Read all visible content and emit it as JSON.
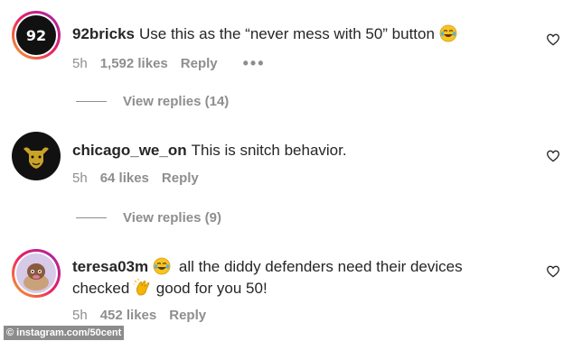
{
  "comments": [
    {
      "username": "92bricks",
      "text_before": "Use this as the “never mess with 50” button",
      "text_after": "",
      "time": "5h",
      "likes": "1,592 likes",
      "reply": "Reply",
      "more": "•••",
      "view_replies": "View replies (14)",
      "avatar_text": "92"
    },
    {
      "username": "chicago_we_on",
      "text_before": "This is snitch behavior.",
      "time": "5h",
      "likes": "64 likes",
      "reply": "Reply",
      "view_replies": "View replies (9)"
    },
    {
      "username": "teresa03m",
      "text_part1": "all the diddy defenders need their devices",
      "text_part2": "checked",
      "text_part3": "good for you 50!",
      "time": "5h",
      "likes": "452 likes",
      "reply": "Reply"
    }
  ],
  "watermark": "© instagram.com/50cent",
  "icons": {
    "heart": "heart-outline-icon",
    "laugh_emoji": "tears-of-joy-emoji",
    "clap_emoji": "clapping-hands-emoji"
  },
  "colors": {
    "text": "#262626",
    "muted": "#8e8e8e",
    "story_ring_start": "#f9a825",
    "story_ring_end": "#9c27b0"
  }
}
